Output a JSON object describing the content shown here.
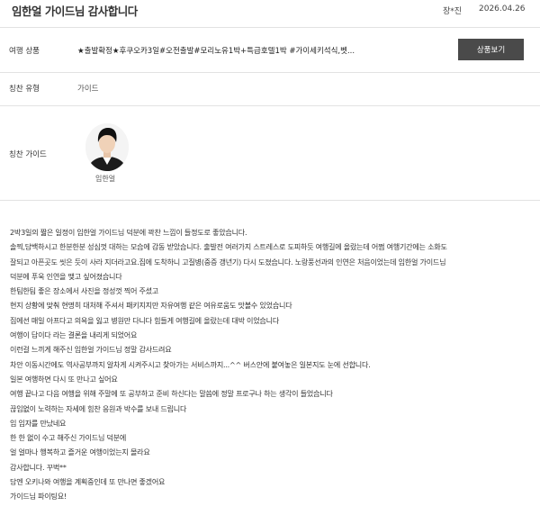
{
  "header": {
    "title": "임한얼 가이드님 감사합니다",
    "author": "장*진",
    "date": "2026.04.26"
  },
  "product": {
    "label": "여행 상품",
    "value": "★출발확정★후쿠오카3일#오전출발#모리노유1박+특급호텔1박 #가이세키석식,벳...",
    "button_label": "상품보기"
  },
  "praise_type": {
    "label": "칭찬 유형",
    "value": "가이드"
  },
  "praise_guide": {
    "label": "칭찬 가이드",
    "name": "임한얼"
  },
  "review": {
    "lines": [
      "2박3일의 짧은 일정이 임한얼 가이드님 덕분에 꽉찬 느낌이 들정도로 좋았습니다.",
      "솔찍,담백하시고 한분한분 성심껏 대하는 모습에 감동 받았습니다. 출발전 여러가지 스트레스로 도피하듯 여행길에 올랐는데 어쩜 여행기간에는 소화도",
      "잘되고 아픈곳도 씻은 듯이 사라 지더라고요.집에 도착하니 고질병(중증 갱년기) 다시 도졌습니다. 노랑풍선과의 인연은 처음이었는데 임한얼 가이드님",
      "덕분에 푸욱 인연을 맺고 싶어졌습니다",
      "한팀한팀 좋은 장소에서 사진을 정성껏 찍어 주셨고",
      "현지 상황에 맞춰 현명히 대처해 주셔서 패키지지만 자유여행 같은 여유로움도 맛볼수 있었습니다",
      "집에선 매일 아프다고 의욕을 잃고 병원만 다니다 힘들게 여행길에 올랐는데 대박 이었습니다",
      "여행이 답이다 라는 결론을 내리게 되었어요",
      "이런걸 느끼게 해주신 임한얼 가이드님 정말 감사드려요",
      "차안 이동시간에도 역사공부까지 알차게 시켜주시고 찾아가는 서비스까지...^^ 버스안에 붙여놓은 일본지도 눈에 선합니다.",
      "일본 여행하면 다시 또 만나고 싶어요",
      "여행 끝나고 다음 여행을 위해 주말에 또 공부하고 준비 하신다는 말씀에 정말 프로구나 하는 생각이 들었습니다",
      "끊임없이 노력하는 자세에 힘찬 응원과 박수를 보내 드립니다",
      "임 임자를 만났네요",
      "한 한 없이 수고 해주신 가이드님 덕분에",
      "얼 얼마나 행복하고 즐거운 여행이었는지 몰라요",
      "감사합니다. 꾸벅**",
      "담엔 오키나와 여행을 계획중인데 또 만나면 좋겠어요",
      "가이드님 파이팅요!"
    ]
  },
  "colors": {
    "button_bg": "#4a4a4a",
    "divider": "#e2e2e2",
    "text": "#333333"
  }
}
